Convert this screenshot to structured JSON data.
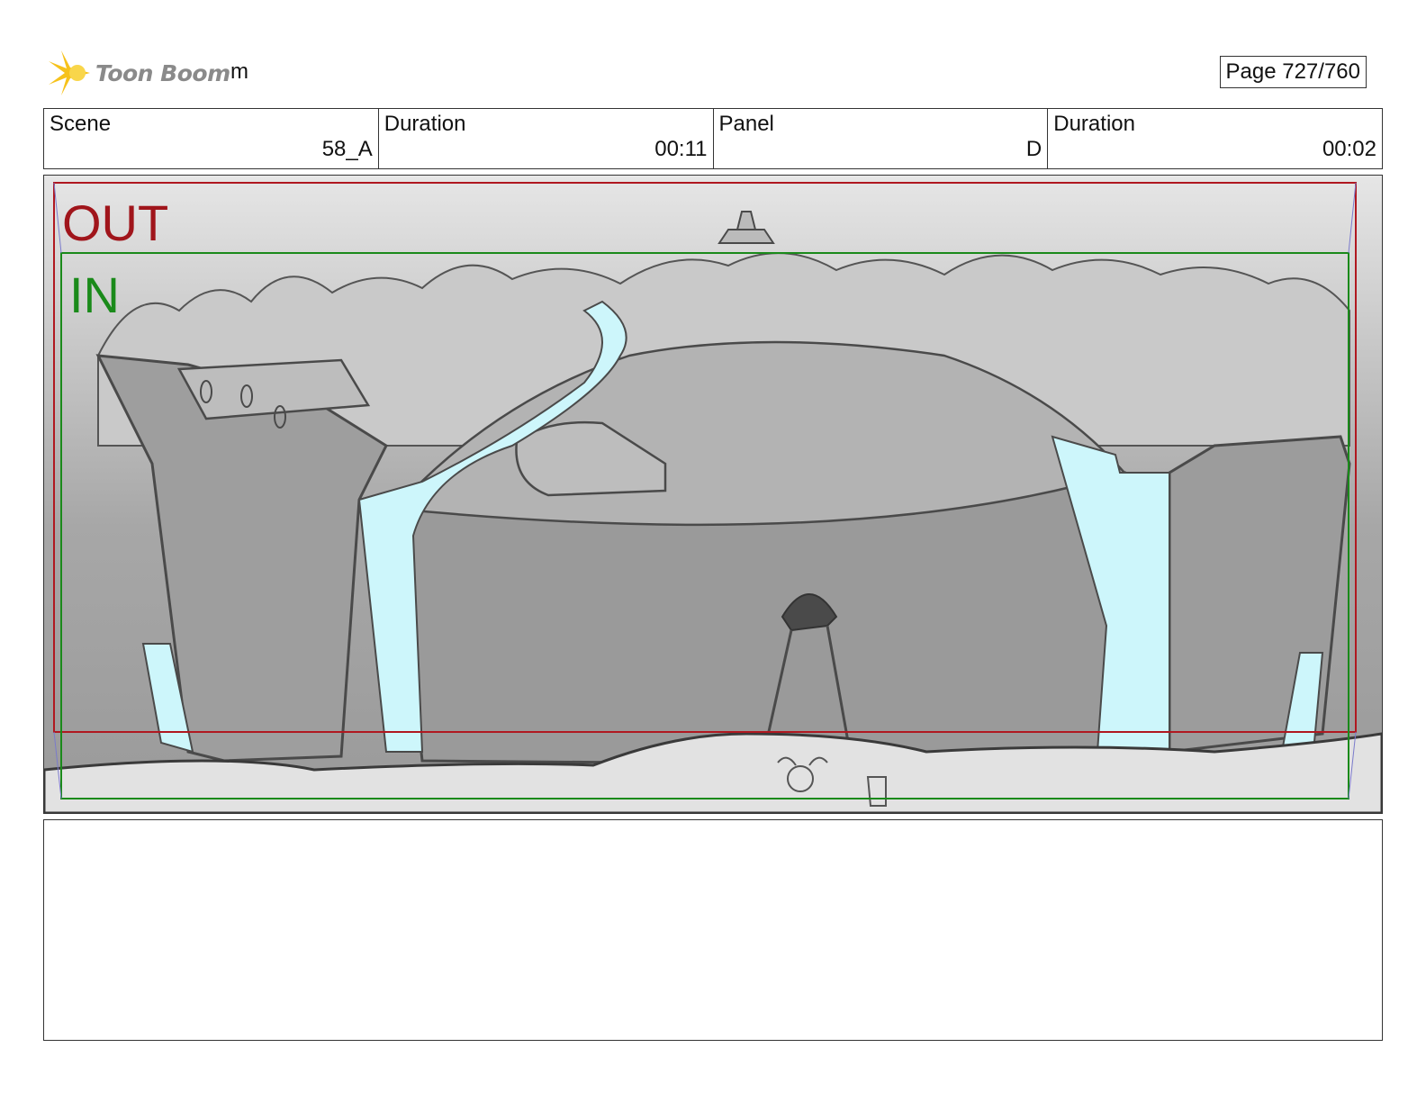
{
  "header": {
    "logo_text": "Toon Boom",
    "project_name": "m",
    "page_label": "Page 727/760"
  },
  "info": [
    {
      "label": "Scene",
      "value": "58_A"
    },
    {
      "label": "Duration",
      "value": "00:11"
    },
    {
      "label": "Panel",
      "value": "D"
    },
    {
      "label": "Duration",
      "value": "00:02"
    }
  ],
  "panel": {
    "out_label": "OUT",
    "in_label": "IN",
    "out_color": "#a0151b",
    "in_color": "#1a8a1a",
    "water_color": "#cdf6fb"
  },
  "notes": {
    "text": ""
  }
}
